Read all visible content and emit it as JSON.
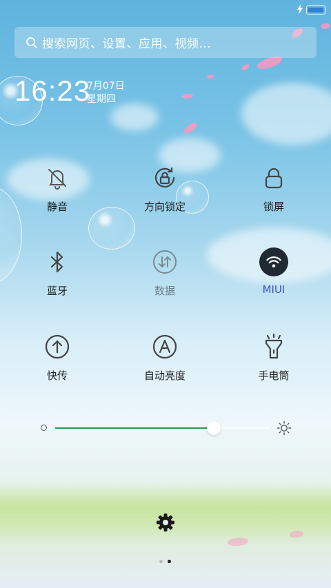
{
  "search": {
    "placeholder": "搜索网页、设置、应用、视频..."
  },
  "clock": {
    "time": "16:23",
    "date": "7月07日",
    "weekday": "星期四"
  },
  "toggles": [
    {
      "label": "静音",
      "icon": "bell-off-icon"
    },
    {
      "label": "方向锁定",
      "icon": "rotation-lock-icon"
    },
    {
      "label": "锁屏",
      "icon": "lock-icon"
    },
    {
      "label": "蓝牙",
      "icon": "bluetooth-icon"
    },
    {
      "label": "数据",
      "icon": "mobile-data-icon"
    },
    {
      "label": "MIUI",
      "icon": "wifi-icon"
    },
    {
      "label": "快传",
      "icon": "upload-icon"
    },
    {
      "label": "自动亮度",
      "icon": "auto-brightness-icon"
    },
    {
      "label": "手电筒",
      "icon": "flashlight-icon"
    }
  ],
  "brightness": {
    "level": 0.74,
    "accent": "#1ea04a"
  },
  "status": {
    "battery_color": "#2f80d8",
    "charging": true
  },
  "pager": {
    "pages": 2,
    "current": 2
  },
  "colors": {
    "wifi_active": "#1f2a33",
    "miui_label": "#3f51c5"
  }
}
